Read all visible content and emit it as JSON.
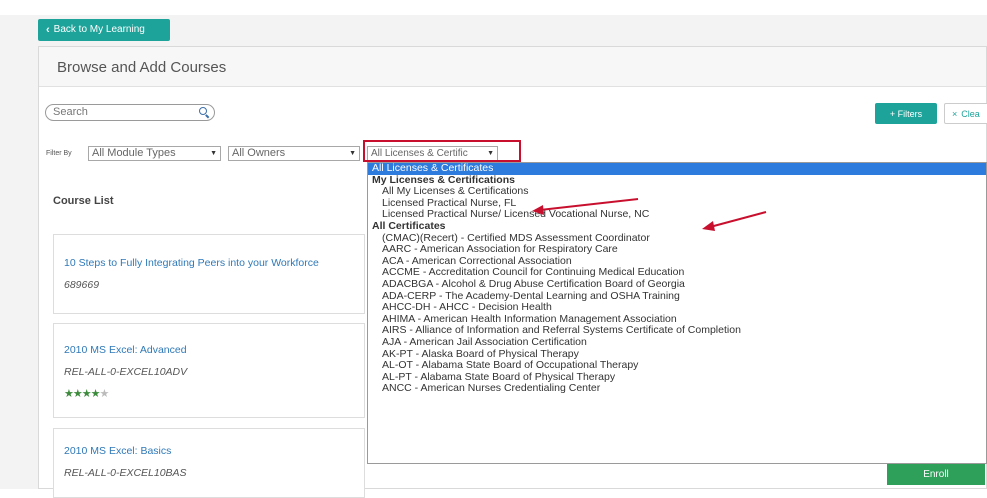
{
  "nav": {
    "back_label": "Back to My Learning"
  },
  "header": {
    "title": "Browse and Add Courses"
  },
  "search": {
    "placeholder": "Search"
  },
  "toolbar": {
    "filters_label": "+ Filters",
    "clear_label": "Clea"
  },
  "filters": {
    "label": "Filter By",
    "module_types": "All Module Types",
    "owners": "All Owners",
    "licenses": "All Licenses & Certific"
  },
  "dropdown": {
    "items": [
      {
        "text": "All Licenses & Certificates",
        "kind": "selected"
      },
      {
        "text": "My Licenses & Certifications",
        "kind": "group"
      },
      {
        "text": "All My Licenses & Certifications",
        "kind": "opt"
      },
      {
        "text": "Licensed Practical Nurse, FL",
        "kind": "opt"
      },
      {
        "text": "Licensed Practical Nurse/ Licensed Vocational Nurse, NC",
        "kind": "opt"
      },
      {
        "text": "All Certificates",
        "kind": "group"
      },
      {
        "text": "(CMAC)(Recert) - Certified MDS Assessment Coordinator",
        "kind": "opt"
      },
      {
        "text": "AARC - American Association for Respiratory Care",
        "kind": "opt"
      },
      {
        "text": "ACA - American Correctional Association",
        "kind": "opt"
      },
      {
        "text": "ACCME - Accreditation Council for Continuing Medical Education",
        "kind": "opt"
      },
      {
        "text": "ADACBGA - Alcohol & Drug Abuse Certification Board of Georgia",
        "kind": "opt"
      },
      {
        "text": "ADA-CERP - The Academy-Dental Learning and OSHA Training",
        "kind": "opt"
      },
      {
        "text": "AHCC-DH - AHCC - Decision Health",
        "kind": "opt"
      },
      {
        "text": "AHIMA - American Health Information Management Association",
        "kind": "opt"
      },
      {
        "text": "AIRS - Alliance of Information and Referral Systems Certificate of Completion",
        "kind": "opt"
      },
      {
        "text": "AJA - American Jail Association Certification",
        "kind": "opt"
      },
      {
        "text": "AK-PT - Alaska Board of Physical Therapy",
        "kind": "opt"
      },
      {
        "text": "AL-OT - Alabama State Board of Occupational Therapy",
        "kind": "opt"
      },
      {
        "text": "AL-PT - Alabama State Board of Physical Therapy",
        "kind": "opt"
      },
      {
        "text": "ANCC - American Nurses Credentialing Center",
        "kind": "opt"
      }
    ]
  },
  "course_list": {
    "title": "Course List",
    "courses": [
      {
        "title": "10 Steps to Fully Integrating Peers into your Workforce",
        "code": "689669"
      },
      {
        "title": "2010 MS Excel: Advanced",
        "code": "REL-ALL-0-EXCEL10ADV",
        "rating": 4
      },
      {
        "title": "2010 MS Excel: Basics",
        "code": "REL-ALL-0-EXCEL10BAS"
      }
    ]
  },
  "enroll_label": "Enroll",
  "colors": {
    "accent": "#1ea39a",
    "selected": "#2d7bdc",
    "highlight": "#c8102e",
    "enroll": "#2ea05a"
  }
}
